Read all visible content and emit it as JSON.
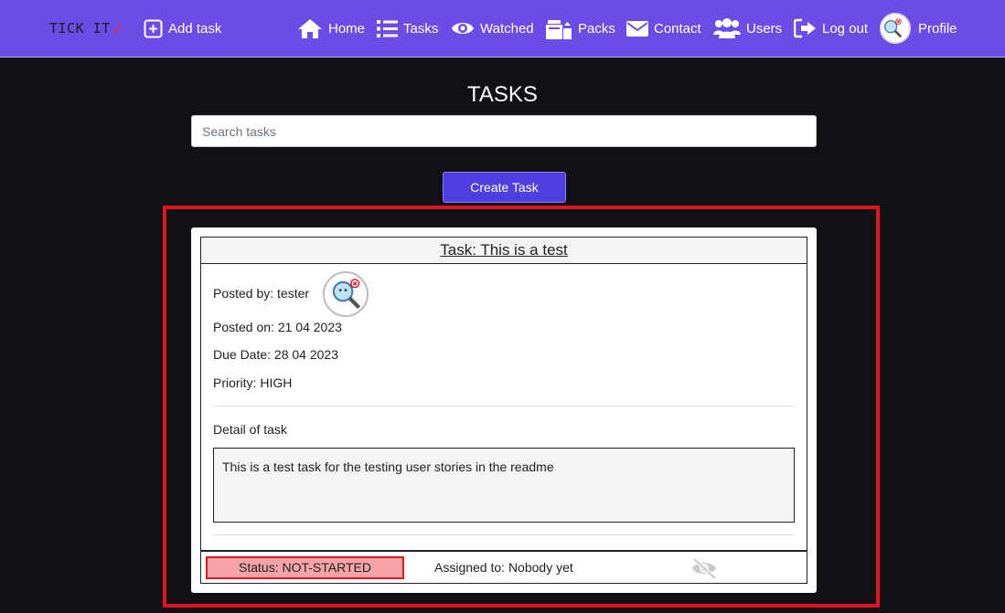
{
  "brand": {
    "name": "TICK IT",
    "mark": "✓"
  },
  "nav": {
    "add_task": "Add task",
    "home": "Home",
    "tasks": "Tasks",
    "watched": "Watched",
    "packs": "Packs",
    "contact": "Contact",
    "users": "Users",
    "logout": "Log out",
    "profile": "Profile"
  },
  "page": {
    "title": "TASKS",
    "search_placeholder": "Search tasks",
    "search_value": "",
    "create_button": "Create Task"
  },
  "task": {
    "title": "Task: This is a test",
    "posted_by": "Posted by: tester",
    "posted_on": "Posted on: 21 04 2023",
    "due_date": "Due Date: 28 04 2023",
    "priority": "Priority: HIGH",
    "detail_label": "Detail of task",
    "detail_text": "This is a test task for the testing user stories in the readme",
    "status": "Status: NOT-STARTED",
    "assigned": "Assigned to: Nobody yet"
  },
  "colors": {
    "navbar": "#6b4de6",
    "background": "#121015",
    "accent_button": "#4f3fe0",
    "highlight": "#e0161f",
    "status_fill": "#f4a3a6"
  },
  "icons": {
    "add": "plus-square-icon",
    "home": "house-icon",
    "tasks": "list-icon",
    "watched": "eye-icon",
    "packs": "boxes-icon",
    "contact": "envelope-icon",
    "users": "users-icon",
    "logout": "logout-icon",
    "watch_toggle": "eye-slash-icon"
  }
}
